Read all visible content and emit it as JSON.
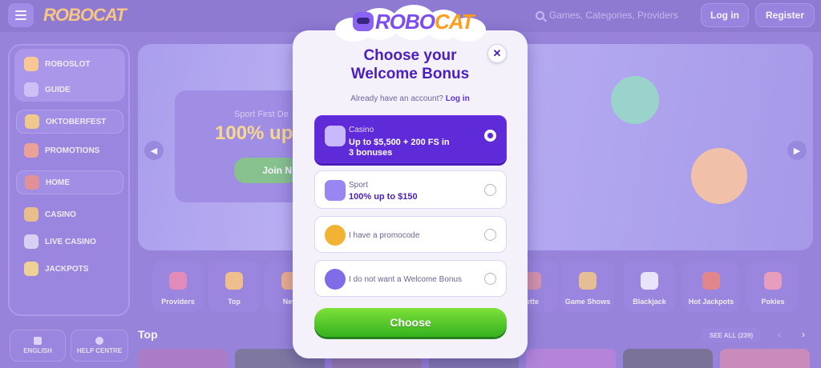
{
  "header": {
    "logo_text": "ROBOCAT",
    "search_placeholder": "Games, Categories, Providers",
    "login_label": "Log in",
    "register_label": "Register"
  },
  "sidebar": {
    "items": [
      {
        "label": "ROBOSLOT",
        "icon": "slot-icon"
      },
      {
        "label": "GUIDE",
        "icon": "guide-icon"
      },
      {
        "label": "OKTOBERFEST",
        "icon": "beer-icon"
      },
      {
        "label": "PROMOTIONS",
        "icon": "gift-icon"
      },
      {
        "label": "HOME",
        "icon": "home-icon"
      },
      {
        "label": "CASINO",
        "icon": "casino-icon"
      },
      {
        "label": "LIVE CASINO",
        "icon": "cards-icon"
      },
      {
        "label": "JACKPOTS",
        "icon": "jackpot-icon"
      }
    ],
    "language_label": "ENGLISH",
    "help_label": "HELP CENTRE"
  },
  "banner": {
    "line1": "Sport First De",
    "line2": "100% up",
    "button_label": "Join N"
  },
  "categories": [
    {
      "label": "Providers"
    },
    {
      "label": "Top"
    },
    {
      "label": "New"
    },
    {
      "label": "ette"
    },
    {
      "label": "Game Shows"
    },
    {
      "label": "Blackjack"
    },
    {
      "label": "Hot Jackpots"
    },
    {
      "label": "Pokies"
    }
  ],
  "section": {
    "title": "Top",
    "see_all": "SEE ALL (239)"
  },
  "modal": {
    "logo_text_a": "ROBO",
    "logo_text_b": "CAT",
    "title_line1": "Choose your",
    "title_line2": "Welcome Bonus",
    "close_symbol": "✕",
    "account_prompt": "Already have an account?",
    "login_link": "Log in",
    "options": [
      {
        "category": "Casino",
        "line1": "Up to $5,500 + 200 FS in",
        "line2": "3 bonuses",
        "selected": true
      },
      {
        "category": "Sport",
        "line1": "100% up to $150",
        "selected": false
      },
      {
        "label": "I have a promocode",
        "selected": false
      },
      {
        "label": "I do not want a Welcome Bonus",
        "selected": false
      }
    ],
    "choose_label": "Choose"
  },
  "colors": {
    "accent": "#5f2bd8",
    "title": "#4a1fbf",
    "choose_green": "#3fbf22",
    "background": "#5b3fc0"
  }
}
